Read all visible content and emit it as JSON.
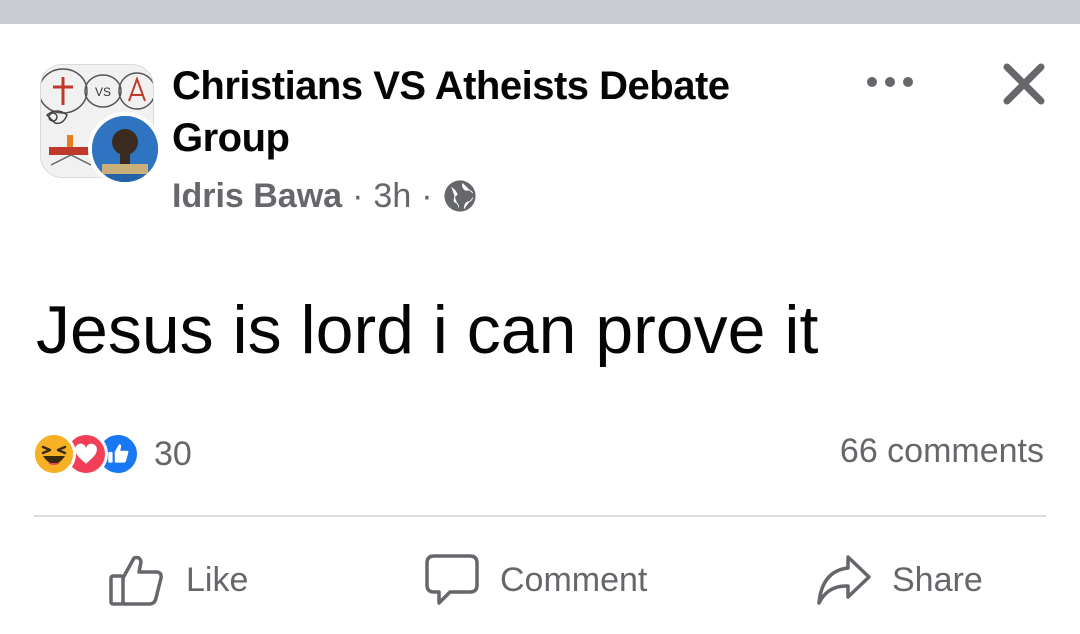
{
  "post": {
    "group_name": "Christians VS Atheists Debate Group",
    "author": "Idris Bawa",
    "separator": "·",
    "time": "3h",
    "privacy_icon": "globe-icon",
    "text": "Jesus is lord i can prove it"
  },
  "group_avatar": {
    "vs_text": "VS"
  },
  "reactions": {
    "icons": [
      "haha-icon",
      "love-icon",
      "like-icon"
    ],
    "count": "30",
    "comments": "66 comments"
  },
  "actions": {
    "like": "Like",
    "comment": "Comment",
    "share": "Share"
  },
  "colors": {
    "text": "#050505",
    "secondary": "#65676b",
    "like_blue": "#1877f2",
    "love_red": "#f33e58",
    "haha_yellow": "#f7b125"
  }
}
